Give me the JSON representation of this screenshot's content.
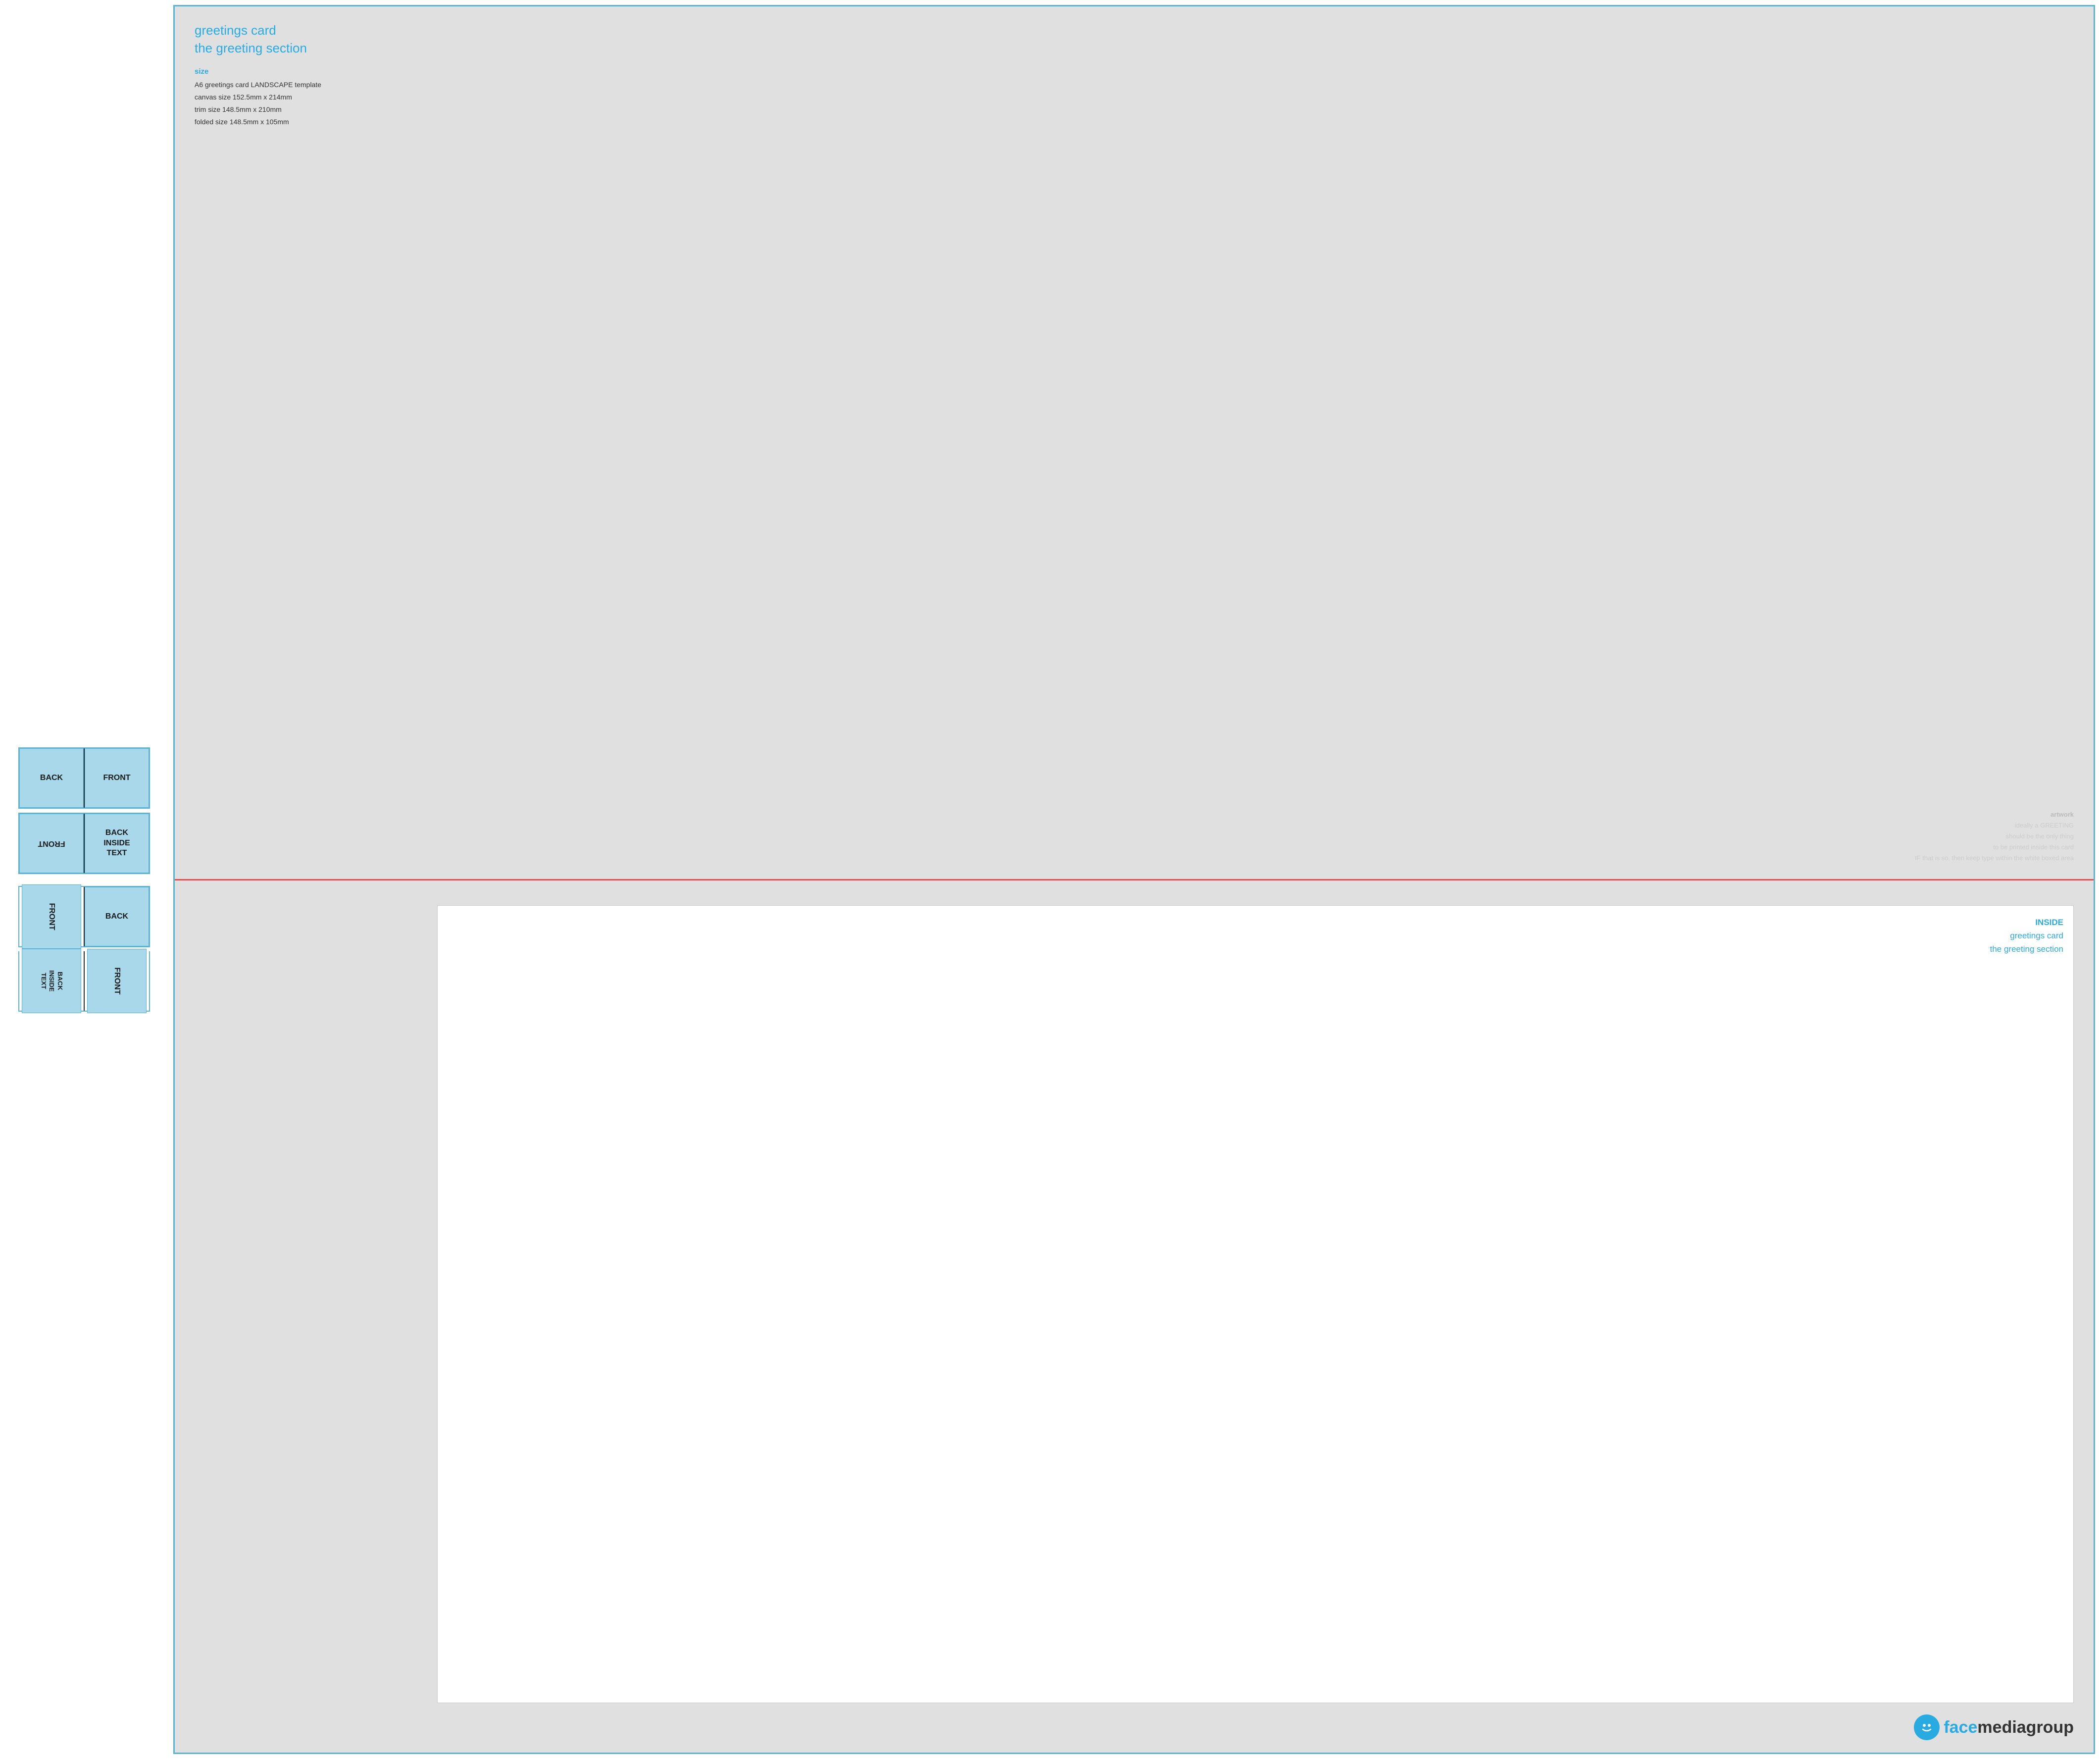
{
  "left": {
    "rows": [
      {
        "id": "row1",
        "cells": [
          {
            "label": "BACK",
            "rotation": "none"
          },
          {
            "label": "FRONT",
            "rotation": "none"
          }
        ]
      },
      {
        "id": "row2",
        "cells": [
          {
            "label": "FRONT",
            "rotation": "180"
          },
          {
            "label": "BACK\nINSIDE\nTEXT",
            "rotation": "none"
          }
        ]
      },
      {
        "id": "row3",
        "cells": [
          {
            "label": "FRONT",
            "rotation": "90cw"
          },
          {
            "label": "BACK",
            "rotation": "none"
          }
        ]
      },
      {
        "id": "row4",
        "cells": [
          {
            "label": "BACK\nINSIDE\nTEXT",
            "rotation": "90cw"
          },
          {
            "label": "FRONT",
            "rotation": "90cw"
          }
        ]
      }
    ]
  },
  "right": {
    "top": {
      "title_line1": "greetings card",
      "title_line2": "the greeting section",
      "size_label": "size",
      "size_line1": "A6 greetings card LANDSCAPE template",
      "size_line2": "canvas size 152.5mm x 214mm",
      "size_line3": "trim size 148.5mm x 210mm",
      "size_line4": "folded size 148.5mm x 105mm",
      "artwork_line1": "artwork",
      "artwork_line2": "ideally a GREETING",
      "artwork_line3": "should be the only thing",
      "artwork_line4": "to be printed inside this card",
      "artwork_line5": "IF that is so, then keep type within the white boxed area"
    },
    "bottom": {
      "inside_label": "INSIDE",
      "card_name": "greetings card",
      "section_name": "the greeting section",
      "logo_face": "face",
      "logo_media": "mediagroup"
    }
  },
  "colors": {
    "cyan": "#29abe2",
    "red_divider": "#e05050",
    "light_blue_card": "#a8d8ea",
    "dark_text": "#1a1a1a",
    "grey_bg": "#e0e0e0"
  }
}
